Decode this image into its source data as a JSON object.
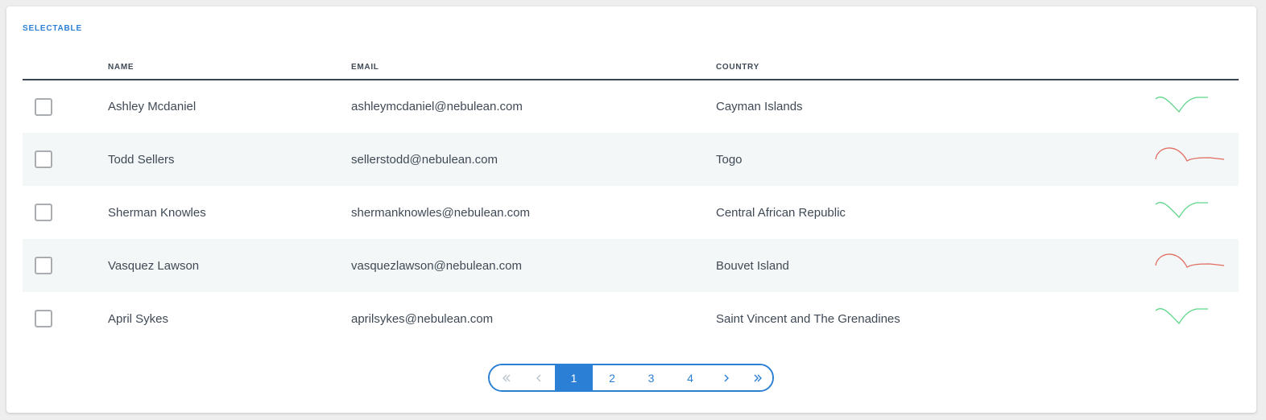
{
  "card": {
    "title": "SELECTABLE"
  },
  "table": {
    "headers": {
      "name": "NAME",
      "email": "EMAIL",
      "country": "COUNTRY"
    },
    "rows": [
      {
        "name": "Ashley Mcdaniel",
        "email": "ashleymcdaniel@nebulean.com",
        "country": "Cayman Islands",
        "checked": false,
        "trend": "up"
      },
      {
        "name": "Todd Sellers",
        "email": "sellerstodd@nebulean.com",
        "country": "Togo",
        "checked": false,
        "trend": "down"
      },
      {
        "name": "Sherman Knowles",
        "email": "shermanknowles@nebulean.com",
        "country": "Central African Republic",
        "checked": false,
        "trend": "up"
      },
      {
        "name": "Vasquez Lawson",
        "email": "vasquezlawson@nebulean.com",
        "country": "Bouvet Island",
        "checked": false,
        "trend": "down"
      },
      {
        "name": "April Sykes",
        "email": "aprilsykes@nebulean.com",
        "country": "Saint Vincent and The Grenadines",
        "checked": false,
        "trend": "up"
      }
    ]
  },
  "colors": {
    "accent": "#2b7fd4",
    "trend_up": "#5fd68a",
    "trend_down": "#e06b5f"
  },
  "pagination": {
    "pages": [
      "1",
      "2",
      "3",
      "4"
    ],
    "current": "1",
    "first_icon": "double-chevron-left-icon",
    "prev_icon": "chevron-left-icon",
    "next_icon": "chevron-right-icon",
    "last_icon": "double-chevron-right-icon"
  }
}
